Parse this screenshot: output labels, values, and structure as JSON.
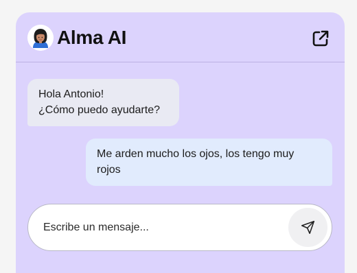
{
  "header": {
    "title": "Alma AI",
    "avatar_icon": "assistant-avatar",
    "open_external_icon": "external-link-icon"
  },
  "messages": [
    {
      "sender": "assistant",
      "lines": [
        "Hola Antonio!",
        "¿Cómo puedo ayudarte?"
      ]
    },
    {
      "sender": "user",
      "lines": [
        "Me arden mucho los ojos, los tengo muy",
        "rojos"
      ]
    }
  ],
  "composer": {
    "placeholder": "Escribe un mensaje...",
    "value": "",
    "send_icon": "send-icon"
  },
  "colors": {
    "panel_background": "#dcd3fd",
    "assistant_bubble": "#e9eaf3",
    "user_bubble": "#e1ebfd",
    "input_background": "#ffffff",
    "send_button_background": "#f0f0f2"
  }
}
